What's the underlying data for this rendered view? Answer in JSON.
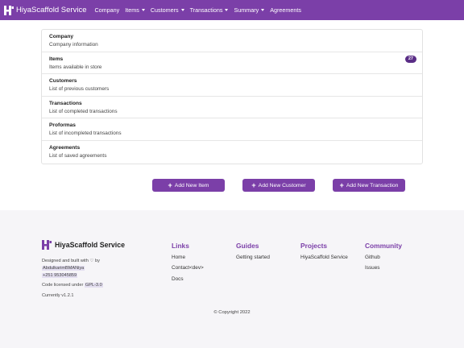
{
  "navbar": {
    "brand": "HiyaScaffold Service",
    "items": [
      {
        "label": "Company",
        "dropdown": false
      },
      {
        "label": "Items",
        "dropdown": true
      },
      {
        "label": "Customers",
        "dropdown": true
      },
      {
        "label": "Transactions",
        "dropdown": true
      },
      {
        "label": "Summary",
        "dropdown": true
      },
      {
        "label": "Agreements",
        "dropdown": false
      }
    ]
  },
  "list": [
    {
      "title": "Company",
      "subtitle": "Company information",
      "badge": ""
    },
    {
      "title": "Items",
      "subtitle": "Items available in store",
      "badge": "27"
    },
    {
      "title": "Customers",
      "subtitle": "List of previous customers",
      "badge": ""
    },
    {
      "title": "Transactions",
      "subtitle": "List of completed transactions",
      "badge": ""
    },
    {
      "title": "Proformas",
      "subtitle": "List of incompleted transactions",
      "badge": ""
    },
    {
      "title": "Agreements",
      "subtitle": "List of saved agreements",
      "badge": ""
    }
  ],
  "actions": {
    "add_item": "Add New Item",
    "add_customer": "Add New Customer",
    "add_transaction": "Add New Transaction"
  },
  "footer": {
    "brand": "HiyaScaffold Service",
    "designed_prefix": "Designed and built with",
    "designed_by": "by",
    "author": "AbdulkarimBMANiya",
    "phone": "+251 953045859",
    "license_prefix": "Code licensed under",
    "license": "GPL-3.0",
    "version": "Currently v1.2.1",
    "columns": {
      "links": {
        "heading": "Links",
        "items": [
          "Home",
          "Contact<dev>",
          "Docs"
        ]
      },
      "guides": {
        "heading": "Guides",
        "items": [
          "Getting started"
        ]
      },
      "projects": {
        "heading": "Projects",
        "items": [
          "HiyaScaffold Service"
        ]
      },
      "community": {
        "heading": "Community",
        "items": [
          "Github",
          "Issues"
        ]
      }
    },
    "copyright": "© Copyright 2022"
  },
  "colors": {
    "primary": "#7b3fa8",
    "badge": "#5a2d86",
    "footer_bg": "#f6f5f8"
  },
  "icons": {
    "brand": "logo-icon",
    "heart": "heart-icon",
    "plus": "plus-icon",
    "caret": "caret-down-icon"
  }
}
